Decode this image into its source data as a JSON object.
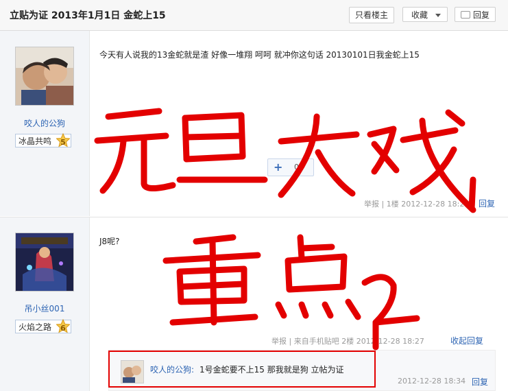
{
  "header": {
    "title": "立贴为证  2013年1月1日  金蛇上15",
    "only_op": "只看楼主",
    "favorite": "收藏",
    "reply": "回复"
  },
  "post1": {
    "username": "咬人的公狗",
    "badge": "冰晶共鸣",
    "level": "5",
    "text": "今天有人说我的13金蛇就是渣  好像一堆翔  呵呵  就冲你这句话  20130101日我金蛇上15",
    "plus_count": "0",
    "meta": "举报  |  1楼   2012-12-28 18:2",
    "reply_label": "回复"
  },
  "post2": {
    "username": "吊小丝001",
    "badge": "火焰之路",
    "level": "6",
    "text": "J8呢?",
    "meta": "举报  |  来自手机贴吧  2楼   2012-12-28 18:27",
    "collapse_label": "收起回复",
    "subreply": {
      "user": "咬人的公狗:",
      "text": " 1号金蛇要不上15  那我就是狗  立帖为证",
      "time": "2012-12-28 18:34",
      "reply_label": "回复"
    }
  },
  "colors": {
    "link": "#2d64b3",
    "annotation": "#e30000"
  }
}
